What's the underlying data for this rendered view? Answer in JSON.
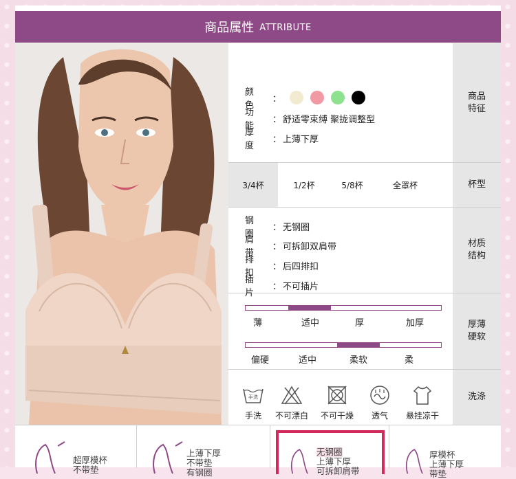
{
  "header": {
    "title_cn": "商品属性",
    "title_en": "ATTRIBUTE"
  },
  "info": {
    "label": "商品\n特征",
    "color_key": "颜色",
    "function_key": "功能",
    "function_value": "舒适零束缚  聚拢调整型",
    "thickness_key": "厚度",
    "thickness_value": "上薄下厚",
    "swatches": [
      "#f3ead2",
      "#f29aa4",
      "#8ee28f",
      "#000000"
    ]
  },
  "cup": {
    "label": "杯型",
    "options": [
      "3/4杯",
      "1/2杯",
      "5/8杯",
      "全罩杯"
    ],
    "selected": "3/4杯"
  },
  "material": {
    "label": "材质\n结构",
    "rows": [
      {
        "key": "钢圈",
        "value": "无钢圈"
      },
      {
        "key": "肩带",
        "value": "可拆卸双肩带"
      },
      {
        "key": "排扣",
        "value": "后四排扣"
      },
      {
        "key": "插片",
        "value": "不可插片"
      }
    ]
  },
  "softness": {
    "label": "厚薄\n硬软",
    "thickness_ticks": [
      "薄",
      "适中",
      "厚",
      "加厚"
    ],
    "thickness_selected": "适中",
    "softness_ticks": [
      "偏硬",
      "适中",
      "柔软",
      "柔"
    ],
    "softness_selected": "柔软"
  },
  "wash": {
    "label": "洗涤",
    "items": [
      {
        "label": "手洗",
        "icon": "hand-wash-icon",
        "badge": "手洗"
      },
      {
        "label": "不可漂白",
        "icon": "no-bleach-icon"
      },
      {
        "label": "不可干燥",
        "icon": "no-tumble-dry-icon"
      },
      {
        "label": "透气",
        "icon": "breathable-icon"
      },
      {
        "label": "悬挂凉干",
        "icon": "hang-dry-icon"
      }
    ]
  },
  "bottom": {
    "items": [
      {
        "line1": "超厚模杯",
        "line2": "不带垫",
        "selected": false
      },
      {
        "line1": "上薄下厚",
        "line2": "不带垫",
        "line3": "有钢圈",
        "selected": false
      },
      {
        "line1": "无钢圈",
        "line2": "上薄下厚",
        "line3": "可拆卸肩带",
        "selected": true
      },
      {
        "line1": "厚模杯",
        "line2": "上薄下厚",
        "line3": "带垫",
        "selected": false
      }
    ]
  }
}
